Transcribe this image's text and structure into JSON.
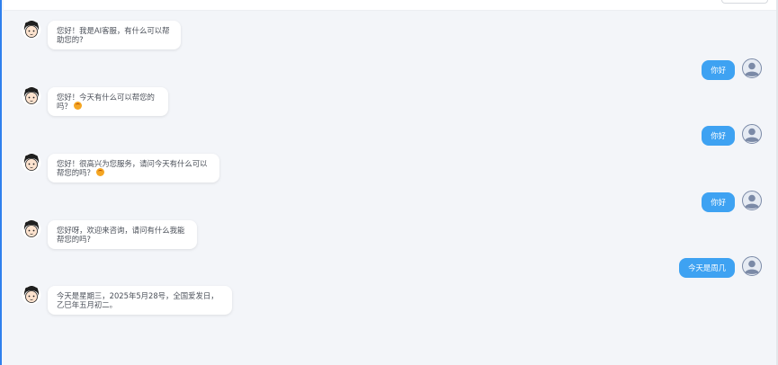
{
  "colors": {
    "accent": "#2f80ed",
    "user_bubble": "#3ea2f2",
    "ai_bubble": "#ffffff",
    "background": "#f3f5f9"
  },
  "chat": {
    "messages": [
      {
        "role": "ai",
        "text": "您好！我是AI客服，有什么可以帮助您的?",
        "emoji": false,
        "avatar_icon": "cartoon-girl-icon"
      },
      {
        "role": "user",
        "text": "你好",
        "avatar_icon": "user-silhouette-icon"
      },
      {
        "role": "ai",
        "text": "您好！今天有什么可以帮您的吗？",
        "emoji": true,
        "avatar_icon": "cartoon-girl-icon"
      },
      {
        "role": "user",
        "text": "你好",
        "avatar_icon": "user-silhouette-icon"
      },
      {
        "role": "ai",
        "text": "您好！很高兴为您服务，请问今天有什么可以帮您的吗？",
        "emoji": true,
        "avatar_icon": "cartoon-girl-icon"
      },
      {
        "role": "user",
        "text": "你好",
        "avatar_icon": "user-silhouette-icon"
      },
      {
        "role": "ai",
        "text": "您好呀，欢迎来咨询，请问有什么我能帮您的吗?",
        "emoji": false,
        "avatar_icon": "cartoon-girl-icon"
      },
      {
        "role": "user",
        "text": "今天是周几",
        "avatar_icon": "user-silhouette-icon"
      },
      {
        "role": "ai",
        "text": "今天是星期三，2025年5月28号，全国爱发日，乙巳年五月初二。",
        "emoji": false,
        "avatar_icon": "cartoon-girl-icon"
      }
    ]
  }
}
